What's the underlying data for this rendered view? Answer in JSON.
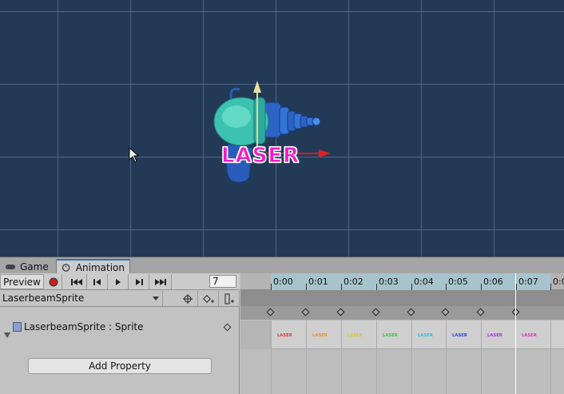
{
  "tabs": {
    "game": "Game",
    "animation": "Animation"
  },
  "scene": {
    "sprite_text": "LASER",
    "sprite_color": "#f01ac8",
    "bg_color": "#233a57"
  },
  "toolbar": {
    "preview_label": "Preview",
    "frame_value": "7"
  },
  "clip": {
    "name": "LaserbeamSprite"
  },
  "property": {
    "label": "LaserbeamSprite : Sprite"
  },
  "add_property_label": "Add Property",
  "ruler": {
    "ticks": [
      "0:00",
      "0:01",
      "0:02",
      "0:03",
      "0:04",
      "0:05",
      "0:06",
      "0:07",
      "0:0"
    ]
  },
  "sprites": [
    {
      "text": "LASER",
      "color": "#e0303a"
    },
    {
      "text": "LASER",
      "color": "#f08a20"
    },
    {
      "text": "LASER",
      "color": "#d8c818"
    },
    {
      "text": "LASER",
      "color": "#36c23a"
    },
    {
      "text": "LASER",
      "color": "#28b8e0"
    },
    {
      "text": "LASER",
      "color": "#2a3ad8"
    },
    {
      "text": "LASER",
      "color": "#9a2ae0"
    },
    {
      "text": "LASER",
      "color": "#e02ac0"
    }
  ]
}
